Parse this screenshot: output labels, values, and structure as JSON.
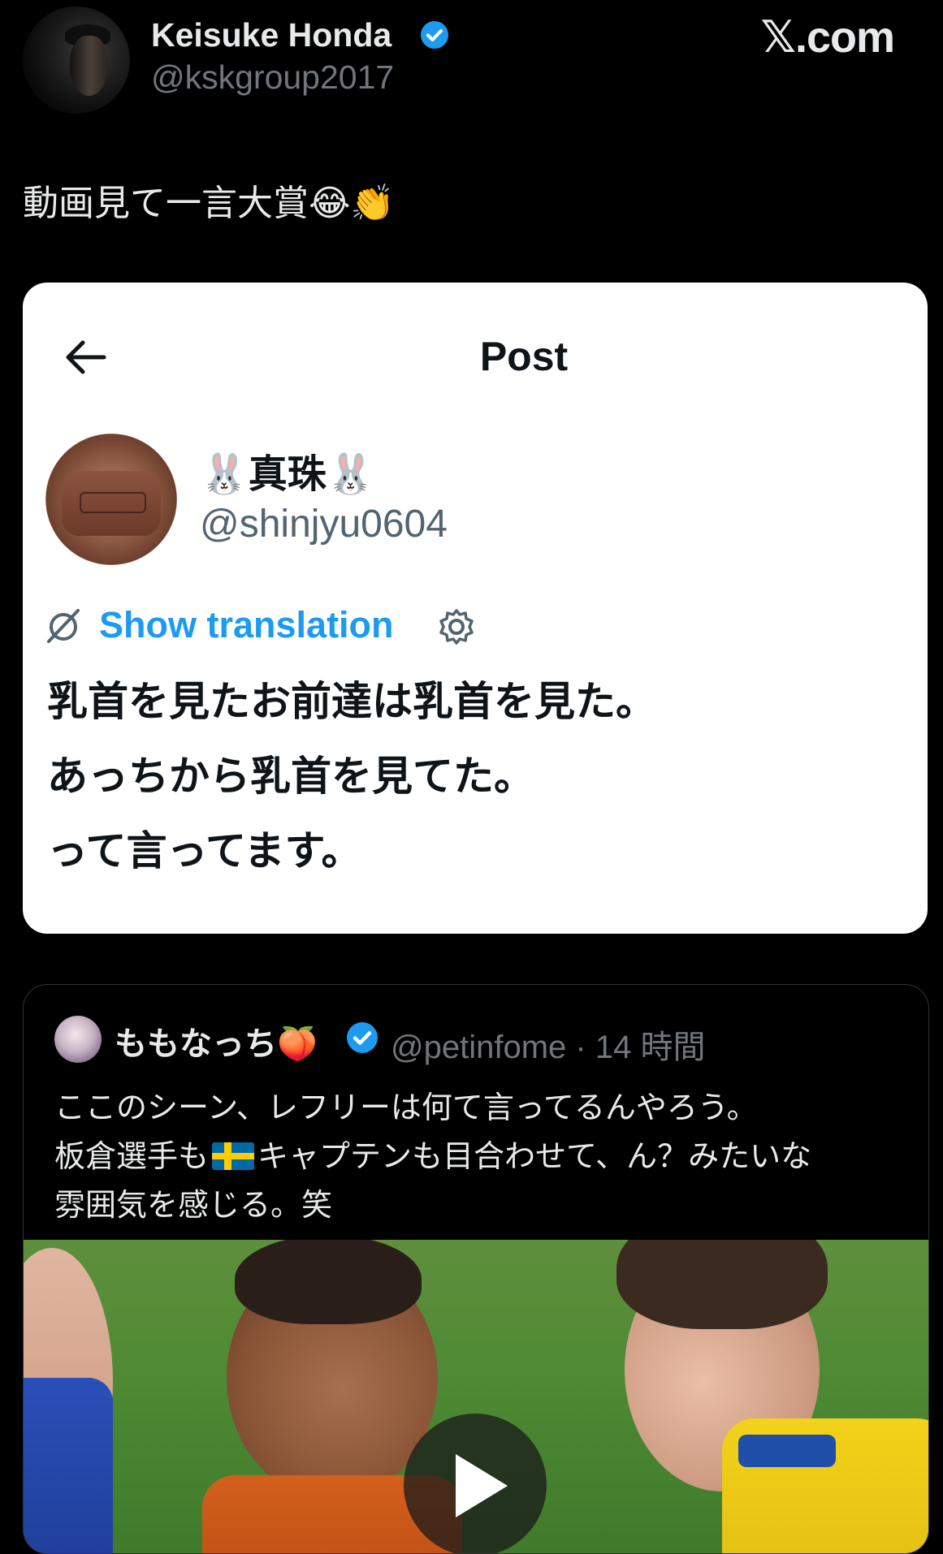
{
  "header": {
    "author_name": "Keisuke Honda",
    "author_handle": "@kskgroup2017",
    "brand": "𝕏.com"
  },
  "tweet": {
    "text": "動画見て一言大賞😂👏"
  },
  "screenshot_card": {
    "title": "Post",
    "name": "🐰真珠🐰",
    "handle": "@shinjyu0604",
    "translation_label": "Show translation",
    "lines": [
      "乳首を見たお前達は乳首を見た。",
      "あっちから乳首を見てた。",
      "って言ってます。"
    ]
  },
  "quote": {
    "name": "ももなっち🍑",
    "handle": "@petinfome",
    "time": "· 14 時間",
    "line1": "ここのシーン、レフリーは何て言ってるんやろう。",
    "line2_a": "板倉選手も",
    "line2_b": "キャプテンも目合わせて、ん？みたいな",
    "line3": "雰囲気を感じる。笑"
  },
  "colors": {
    "background": "#000000",
    "verified": "#1d9bf0",
    "link": "#1d9bf0",
    "secondary_text": "#71767b"
  }
}
